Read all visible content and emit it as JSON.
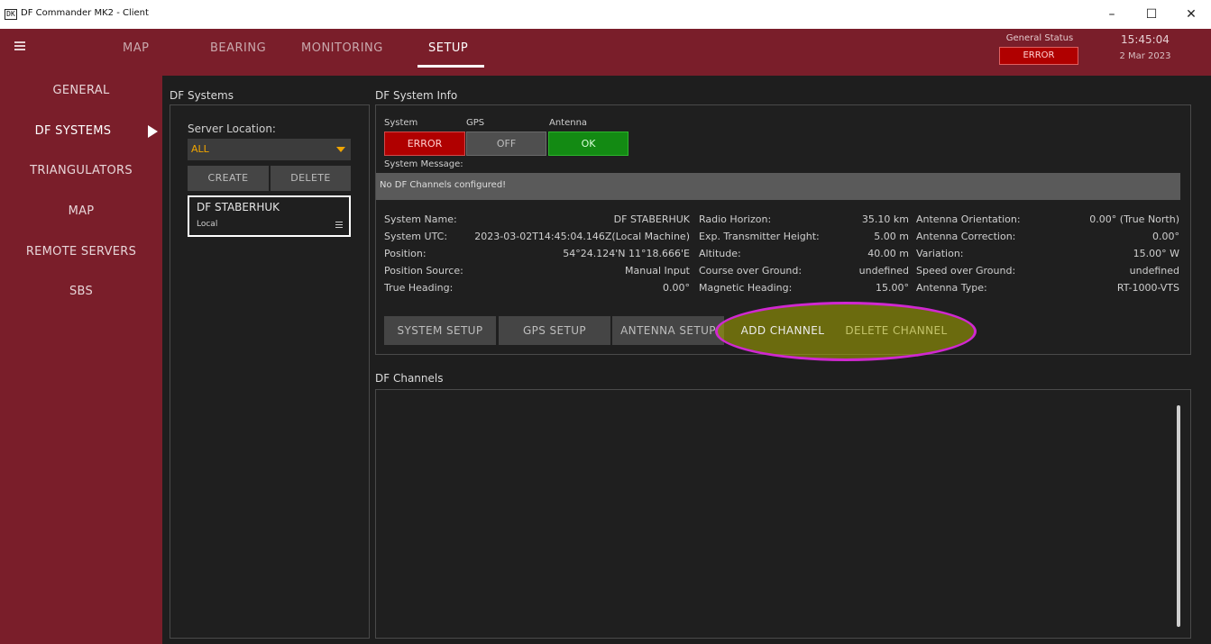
{
  "window": {
    "title": "DF Commander MK2 - Client",
    "minimize": "–",
    "maximize": "☐",
    "close": "✕"
  },
  "topnav": {
    "tabs": [
      "MAP",
      "BEARING",
      "MONITORING",
      "SETUP"
    ],
    "active_tab": "SETUP",
    "general_status_label": "General Status",
    "general_status_value": "ERROR",
    "time": "15:45:04",
    "date": "2 Mar 2023"
  },
  "sidebar": {
    "items": [
      "GENERAL",
      "DF SYSTEMS",
      "TRIANGULATORS",
      "MAP",
      "REMOTE SERVERS",
      "SBS"
    ],
    "active_item": "DF SYSTEMS"
  },
  "df_systems": {
    "title": "DF Systems",
    "server_location_label": "Server Location:",
    "server_location_value": "ALL",
    "create_label": "CREATE",
    "delete_label": "DELETE",
    "systems": [
      {
        "name": "DF STABERHUK",
        "location": "Local"
      }
    ]
  },
  "df_system_info": {
    "title": "DF System Info",
    "status": {
      "system_label": "System",
      "gps_label": "GPS",
      "antenna_label": "Antenna",
      "system_value": "ERROR",
      "gps_value": "OFF",
      "antenna_value": "OK"
    },
    "system_message_label": "System Message:",
    "system_message": "No DF Channels configured!",
    "fields": {
      "system_name_label": "System Name:",
      "system_name": "DF STABERHUK",
      "system_utc_label": "System UTC:",
      "system_utc": "2023-03-02T14:45:04.146Z(Local Machine)",
      "position_label": "Position:",
      "position": "54°24.124'N 11°18.666'E",
      "position_source_label": "Position Source:",
      "position_source": "Manual Input",
      "true_heading_label": "True Heading:",
      "true_heading": "0.00°",
      "radio_horizon_label": "Radio Horizon:",
      "radio_horizon": "35.10 km",
      "exp_tx_height_label": "Exp. Transmitter Height:",
      "exp_tx_height": "5.00 m",
      "altitude_label": "Altitude:",
      "altitude": "40.00 m",
      "cog_label": "Course over Ground:",
      "cog": "undefined",
      "magnetic_heading_label": "Magnetic Heading:",
      "magnetic_heading": "15.00°",
      "antenna_orientation_label": "Antenna Orientation:",
      "antenna_orientation": "0.00° (True North)",
      "antenna_correction_label": "Antenna Correction:",
      "antenna_correction": "0.00°",
      "variation_label": "Variation:",
      "variation": "15.00° W",
      "sog_label": "Speed over Ground:",
      "sog": "undefined",
      "antenna_type_label": "Antenna Type:",
      "antenna_type": "RT-1000-VTS"
    },
    "buttons": {
      "system_setup": "SYSTEM SETUP",
      "gps_setup": "GPS SETUP",
      "antenna_setup": "ANTENNA SETUP",
      "add_channel": "ADD CHANNEL",
      "delete_channel": "DELETE CHANNEL"
    }
  },
  "df_channels": {
    "title": "DF Channels"
  },
  "colors": {
    "brand": "#7a1e2a",
    "error": "#b00000",
    "ok": "#138a13",
    "accent": "#f0a500",
    "annotation": "#d028d0"
  }
}
